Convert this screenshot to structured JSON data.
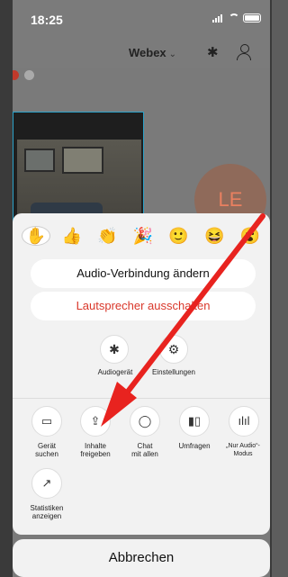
{
  "status": {
    "time": "18:25"
  },
  "header": {
    "brand": "Webex",
    "brand_chevron": "⌄"
  },
  "video": {
    "avatar_initials": "LE"
  },
  "reactions": [
    {
      "name": "raise-hand-icon",
      "glyph": "✋"
    },
    {
      "name": "thumbs-up-icon",
      "glyph": "👍"
    },
    {
      "name": "clap-icon",
      "glyph": "👏"
    },
    {
      "name": "celebrate-icon",
      "glyph": "🎉"
    },
    {
      "name": "smile-icon",
      "glyph": "🙂"
    },
    {
      "name": "laugh-icon",
      "glyph": "😆"
    },
    {
      "name": "surprised-icon",
      "glyph": "😮"
    }
  ],
  "sheet": {
    "audio_change": "Audio-Verbindung ändern",
    "speaker_off": "Lautsprecher ausschalten",
    "audio_device_label": "Audiogerät",
    "settings_label": "Einstellungen"
  },
  "tools": [
    {
      "line1": "Gerät",
      "line2": "suchen",
      "icon": "cast-icon"
    },
    {
      "line1": "Inhalte",
      "line2": "freigeben",
      "icon": "share-icon"
    },
    {
      "line1": "Chat",
      "line2": "mit allen",
      "icon": "chat-icon"
    },
    {
      "line1": "Umfragen",
      "line2": "",
      "icon": "polls-icon"
    },
    {
      "line1": "„Nur Audio“-",
      "line2": "Modus",
      "icon": "audio-only-icon"
    },
    {
      "line1": "Statistiken",
      "line2": "anzeigen",
      "icon": "statistics-icon"
    }
  ],
  "cancel_label": "Abbrechen",
  "colors": {
    "danger": "#d9372a",
    "arrow": "#e8231f",
    "video_border": "#2ba2c9"
  }
}
